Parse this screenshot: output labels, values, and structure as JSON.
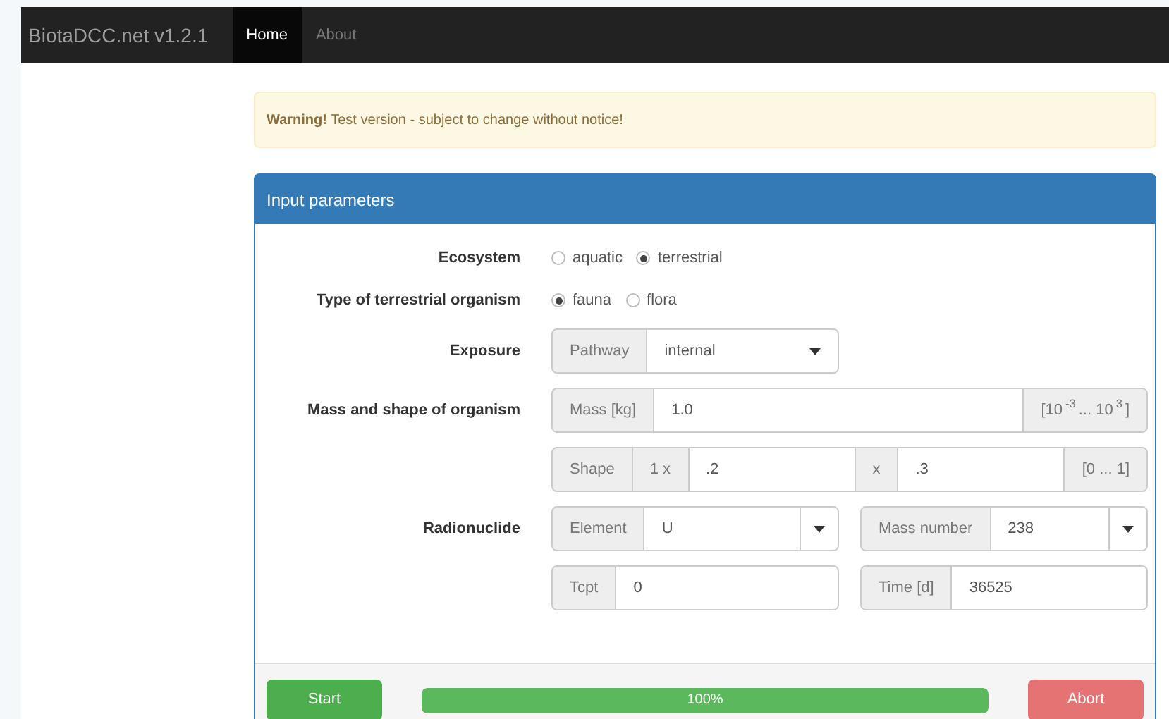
{
  "navbar": {
    "brand": "BiotaDCC.net v1.2.1",
    "links": [
      {
        "label": "Home",
        "selected": true
      },
      {
        "label": "About",
        "selected": false
      }
    ]
  },
  "alert": {
    "title": "Warning!",
    "message": "Test version - subject to change without notice!"
  },
  "panel": {
    "title": "Input parameters",
    "rows": [
      {
        "label": "Ecosystem",
        "kind": "radio",
        "options": [
          {
            "label": "aquatic",
            "selected": false
          },
          {
            "label": "terrestrial",
            "selected": true
          }
        ]
      },
      {
        "label": "Type of terrestrial organism",
        "kind": "radio",
        "options": [
          {
            "label": "fauna",
            "selected": true
          },
          {
            "label": "flora",
            "selected": false
          }
        ]
      },
      {
        "label": "Exposure",
        "kind": "fields",
        "groups": [
          {
            "wide": false,
            "parts": [
              {
                "kind": "addon",
                "text": "Pathway"
              },
              {
                "kind": "select",
                "value": "internal"
              }
            ]
          }
        ]
      },
      {
        "label": "Mass and shape of organism",
        "kind": "fields",
        "groups": [
          {
            "wide": true,
            "parts": [
              {
                "kind": "addon",
                "text": "Mass [kg]"
              },
              {
                "kind": "input",
                "value": "1.0"
              },
              {
                "kind": "addon",
                "text": "[10$^{-3}$ ... 10$^{3}$]"
              }
            ]
          }
        ]
      },
      {
        "kind": "fields",
        "groups": [
          {
            "wide": true,
            "parts": [
              {
                "kind": "addon",
                "text": "Shape"
              },
              {
                "kind": "addon",
                "text": "1 x"
              },
              {
                "kind": "input",
                "value": ".2"
              },
              {
                "kind": "addon",
                "text": "x"
              },
              {
                "kind": "input",
                "value": ".3"
              },
              {
                "kind": "addon",
                "text": "[0 ... 1]"
              }
            ]
          }
        ]
      },
      {
        "label": "Radionuclide",
        "kind": "fields",
        "groups": [
          {
            "wide": false,
            "parts": [
              {
                "kind": "addon",
                "text": "Element"
              },
              {
                "kind": "input",
                "value": "U"
              },
              {
                "kind": "caret"
              }
            ]
          },
          {
            "wide": false,
            "parts": [
              {
                "kind": "addon",
                "text": "Mass number"
              },
              {
                "kind": "input",
                "value": "238"
              },
              {
                "kind": "caret"
              }
            ]
          }
        ]
      },
      {
        "kind": "fields",
        "groups": [
          {
            "wide": false,
            "parts": [
              {
                "kind": "addon",
                "text": "Tcpt"
              },
              {
                "kind": "input",
                "value": "0"
              }
            ]
          },
          {
            "wide": false,
            "parts": [
              {
                "kind": "addon",
                "text": "Time [d]"
              },
              {
                "kind": "input",
                "value": "36525"
              }
            ]
          }
        ]
      }
    ]
  },
  "footer": {
    "start": "Start",
    "progress": {
      "level": 1,
      "text": "100%"
    },
    "abort": "Abort"
  }
}
